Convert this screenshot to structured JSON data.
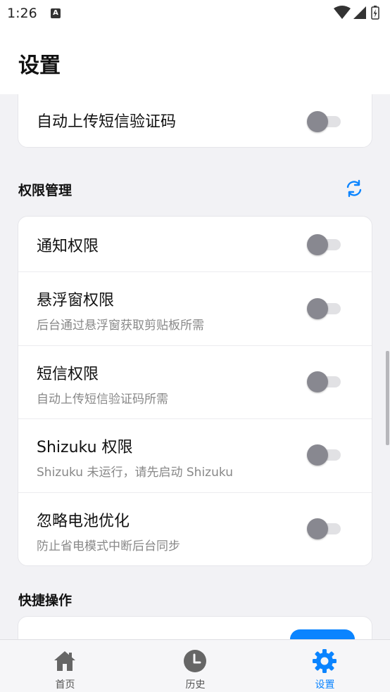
{
  "status_bar": {
    "time": "1:26",
    "notification_icon": "a-icon"
  },
  "header": {
    "title": "设置"
  },
  "top_card": {
    "sms_upload": {
      "title": "自动上传短信验证码",
      "enabled": false
    }
  },
  "permissions": {
    "section_title": "权限管理",
    "refresh_icon": "refresh-icon",
    "items": [
      {
        "title": "通知权限",
        "subtitle": "",
        "enabled": false
      },
      {
        "title": "悬浮窗权限",
        "subtitle": "后台通过悬浮窗获取剪贴板所需",
        "enabled": false
      },
      {
        "title": "短信权限",
        "subtitle": "自动上传短信验证码所需",
        "enabled": false
      },
      {
        "title": "Shizuku 权限",
        "subtitle": "Shizuku 未运行，请先启动 Shizuku",
        "enabled": false
      },
      {
        "title": "忽略电池优化",
        "subtitle": "防止省电模式中断后台同步",
        "enabled": false
      }
    ]
  },
  "quick_actions": {
    "section_title": "快捷操作"
  },
  "nav": {
    "items": [
      {
        "label": "首页",
        "icon": "home-icon",
        "active": false
      },
      {
        "label": "历史",
        "icon": "clock-icon",
        "active": false
      },
      {
        "label": "设置",
        "icon": "gear-icon",
        "active": true
      }
    ]
  },
  "colors": {
    "accent": "#0a84ff",
    "background": "#f2f2f5",
    "toggle_off": "#888890"
  }
}
